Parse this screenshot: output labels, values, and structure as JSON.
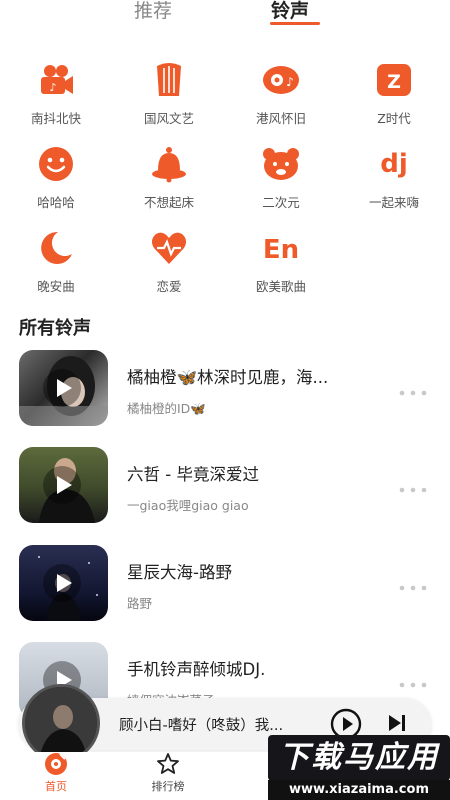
{
  "top_tabs": [
    {
      "label": "推荐",
      "active": false
    },
    {
      "label": "铃声",
      "active": true
    }
  ],
  "categories": [
    {
      "label": "南抖北快",
      "icon": "film-camera-icon"
    },
    {
      "label": "国风文艺",
      "icon": "guzheng-icon"
    },
    {
      "label": "港风怀旧",
      "icon": "record-note-icon"
    },
    {
      "label": "Z时代",
      "icon": "z-badge-icon"
    },
    {
      "label": "哈哈哈",
      "icon": "smile-icon"
    },
    {
      "label": "不想起床",
      "icon": "alarm-bell-icon"
    },
    {
      "label": "二次元",
      "icon": "bear-icon"
    },
    {
      "label": "一起来嗨",
      "icon": "dj-icon"
    },
    {
      "label": "晚安曲",
      "icon": "moon-icon"
    },
    {
      "label": "恋爱",
      "icon": "heart-pulse-icon"
    },
    {
      "label": "欧美歌曲",
      "icon": "en-icon"
    }
  ],
  "section_title": "所有铃声",
  "songs": [
    {
      "title": "橘柚橙🦋林深时见鹿，海...",
      "artist": "橘柚橙的ID🦋"
    },
    {
      "title": "六哲 - 毕竟深爱过",
      "artist": "一giao我哩giao giao"
    },
    {
      "title": "星辰大海-路野",
      "artist": "路野"
    },
    {
      "title": "手机铃声醉倾城DJ.",
      "artist": "嫱佣寐沈嵛菜子"
    }
  ],
  "mini_player": {
    "title": "顾小白-嗜好（咚鼓）我..."
  },
  "bottom_nav": [
    {
      "label": "首页",
      "active": true,
      "icon": "home-disc-icon"
    },
    {
      "label": "排行榜",
      "active": false,
      "icon": "star-icon"
    }
  ],
  "watermark": {
    "main": "下载马应用",
    "sub": "www.xiazaima.com"
  },
  "colors": {
    "accent": "#ef5a2a",
    "text": "#222222",
    "muted": "#888888"
  }
}
